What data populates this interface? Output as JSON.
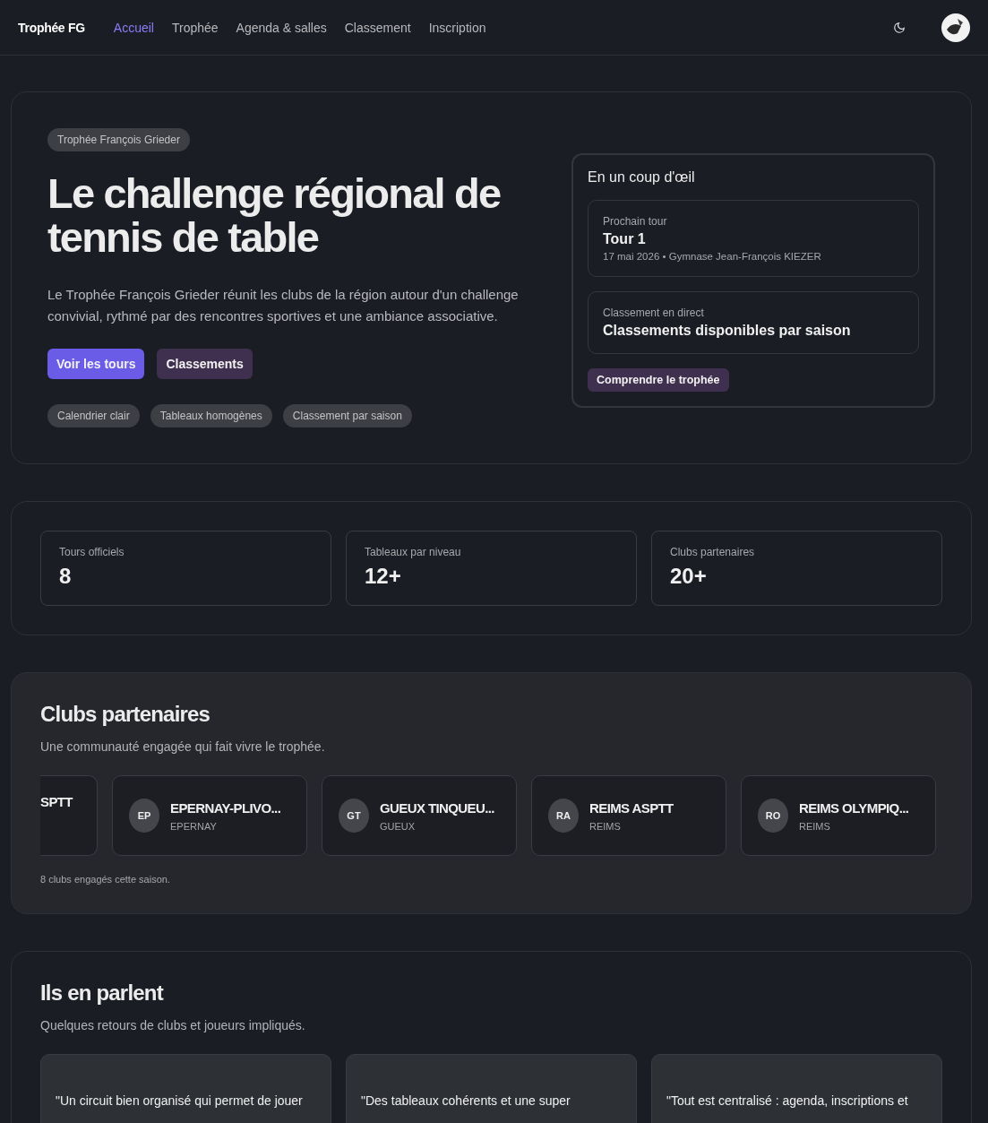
{
  "nav": {
    "brand": "Trophée FG",
    "links": [
      {
        "label": "Accueil",
        "selected": true
      },
      {
        "label": "Trophée",
        "selected": false
      },
      {
        "label": "Agenda & salles",
        "selected": false
      },
      {
        "label": "Classement",
        "selected": false
      },
      {
        "label": "Inscription",
        "selected": false
      }
    ]
  },
  "hero": {
    "badge": "Trophée François Grieder",
    "title": "Le challenge régional de tennis de table",
    "lead": "Le Trophée François Grieder réunit les clubs de la région autour d'un challenge convivial, rythmé par des rencontres sportives et une ambiance associative.",
    "buttons": [
      {
        "label": "Voir les tours",
        "kind": "primary"
      },
      {
        "label": "Classements",
        "kind": "secondary"
      }
    ],
    "tags": [
      "Calendrier clair",
      "Tableaux homogènes",
      "Classement par saison"
    ],
    "glance": {
      "title": "En un coup d'œil",
      "cards": [
        {
          "label": "Prochain tour",
          "value": "Tour 1",
          "detail": "17 mai 2026 • Gymnase Jean-François KIEZER"
        },
        {
          "label": "Classement en direct",
          "value": "Classements disponibles par saison"
        }
      ],
      "button": "Comprendre le trophée"
    }
  },
  "stats": [
    {
      "label": "Tours officiels",
      "value": "8"
    },
    {
      "label": "Tableaux par niveau",
      "value": "12+"
    },
    {
      "label": "Clubs partenaires",
      "value": "20+"
    }
  ],
  "clubs": {
    "title": "Clubs partenaires",
    "subtitle": "Une communauté engagée qui fait vivre le trophée.",
    "items": [
      {
        "kind": "partial",
        "name": "SPTT"
      },
      {
        "kind": "full",
        "initials": "EP",
        "name": "EPERNAY-PLIVO...",
        "city": "EPERNAY"
      },
      {
        "kind": "full",
        "initials": "GT",
        "name": "GUEUX TINQUEU...",
        "city": "GUEUX"
      },
      {
        "kind": "full",
        "initials": "RA",
        "name": "REIMS ASPTT",
        "city": "REIMS"
      },
      {
        "kind": "full",
        "initials": "RO",
        "name": "REIMS OLYMPIQ...",
        "city": "REIMS"
      }
    ],
    "footer": "8 clubs engagés cette saison."
  },
  "testimonials": {
    "title": "Ils en parlent",
    "subtitle": "Quelques retours de clubs et joueurs impliqués.",
    "quotes": [
      "\"Un circuit bien organisé qui permet de jouer",
      "\"Des tableaux cohérents et une super",
      "\"Tout est centralisé : agenda, inscriptions et"
    ]
  }
}
